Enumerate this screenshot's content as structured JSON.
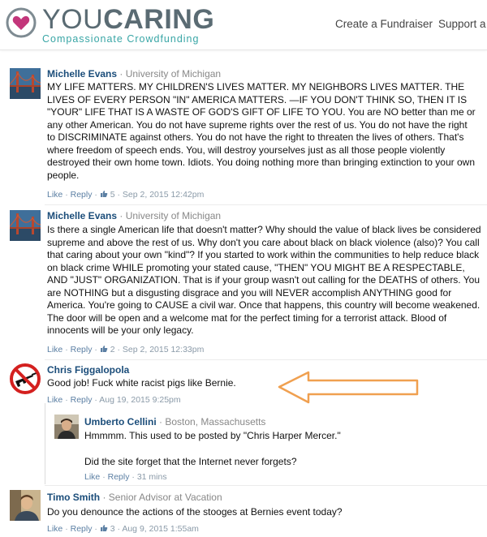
{
  "header": {
    "logo_you": "YOU",
    "logo_caring": "CARING",
    "logo_tagline": "Compassionate Crowdfunding",
    "nav": [
      "Create a Fundraiser",
      "Support a"
    ]
  },
  "comments": [
    {
      "name": "Michelle Evans",
      "affiliation": "· University of Michigan",
      "text": "MY LIFE MATTERS. MY CHILDREN'S LIVES MATTER. MY NEIGHBORS LIVES MATTER. THE LIVES OF EVERY PERSON \"IN\" AMERICA MATTERS. —IF YOU DON'T THINK SO, THEN IT IS \"YOUR\" LIFE THAT IS A WASTE OF GOD'S GIFT OF LIFE TO YOU. You are NO better than me or any other American. You do not have supreme rights over the rest of us. You do not have the right to DISCRIMINATE against others. You do not have the right to threaten the lives of others. That's where freedom of speech ends. You, will destroy yourselves just as all those people violently destroyed their own home town. Idiots. You doing nothing more than bringing extinction to your own people.",
      "like": "Like",
      "reply": "Reply",
      "count": "5",
      "timestamp": "Sep 2, 2015 12:42pm"
    },
    {
      "name": "Michelle Evans",
      "affiliation": "· University of Michigan",
      "text": "Is there a single American life that doesn't matter? Why should the value of black lives be considered supreme and above the rest of us. Why don't you care about black on black violence (also)? You call that caring about your own \"kind\"? If you started to work within the communities to help reduce black on black crime WHILE promoting your stated cause, \"THEN\" YOU MIGHT BE A RESPECTABLE, AND \"JUST\" ORGANIZATION. That is if your group wasn't out calling for the DEATHS of others. You are NOTHING but a disgusting disgrace and you will NEVER accomplish ANYTHING good for America. You're going to CAUSE a civil war. Once that happens, this country will become weakened. The door will be open and a welcome mat for the perfect timing for a terrorist attack. Blood of innocents will be your only legacy.",
      "like": "Like",
      "reply": "Reply",
      "count": "2",
      "timestamp": "Sep 2, 2015 12:33pm"
    },
    {
      "name": "Chris Figgalopola",
      "affiliation": "",
      "text": "Good job! Fuck white racist pigs like Bernie.",
      "like": "Like",
      "reply": "Reply",
      "count": "",
      "timestamp": "Aug 19, 2015 9:25pm"
    },
    {
      "name": "Umberto Cellini",
      "affiliation": "· Boston, Massachusetts",
      "text": "Hmmmm. This used to be posted by \"Chris Harper Mercer.\"",
      "text2": "Did the site forget that the Internet never forgets?",
      "like": "Like",
      "reply": "Reply",
      "count": "",
      "timestamp": "31 mins"
    },
    {
      "name": "Timo Smith",
      "affiliation": "· Senior Advisor at Vacation",
      "text": "Do you denounce the actions of the stooges at Bernies event today?",
      "like": "Like",
      "reply": "Reply",
      "count": "3",
      "timestamp": "Aug 9, 2015 1:55am"
    }
  ],
  "sep": "·",
  "icons": {
    "logo": "heart-logo-icon",
    "thumb": "thumbs-up-icon",
    "avatar_bridge": "golden-gate-bridge-avatar",
    "avatar_no_guns": "no-guns-sign-avatar",
    "avatar_person": "person-photo-avatar",
    "annotation": "orange-arrow-annotation"
  },
  "colors": {
    "name_link": "#1b4d7a",
    "meta": "#8a9aa8",
    "brand_teal": "#39a6a6",
    "arrow": "#f0a050"
  }
}
